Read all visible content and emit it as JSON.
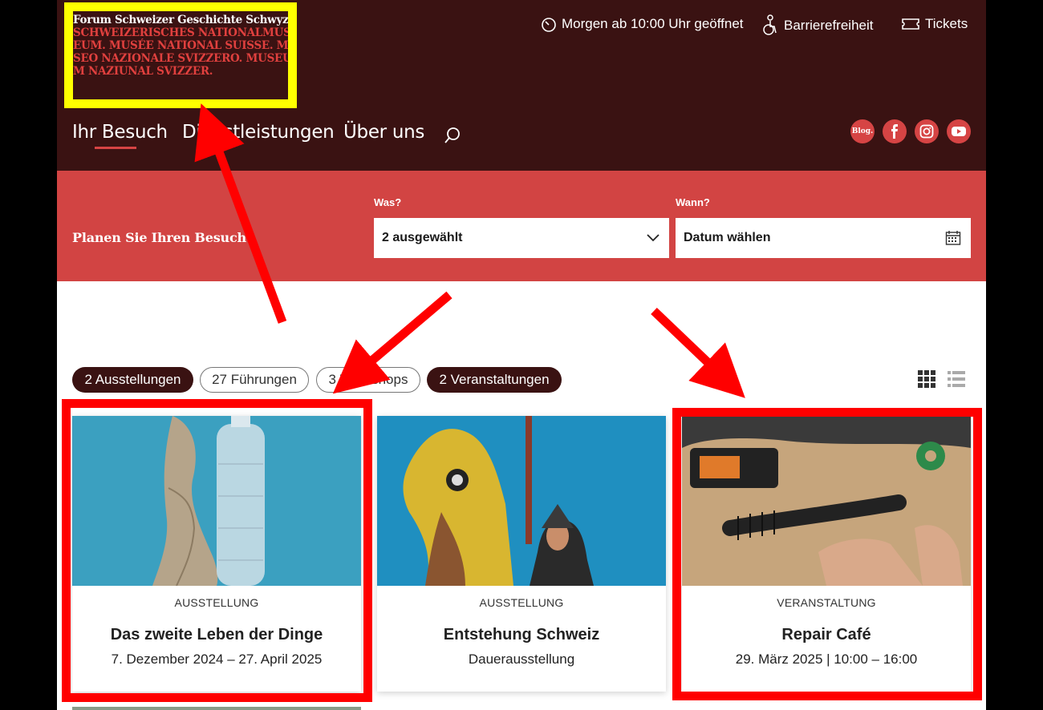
{
  "logo": {
    "line1": "Forum Schweizer Geschichte Schwyz.",
    "line2": "SCHWEIZERISCHES NATIONALMUS",
    "line3": "EUM. MUSÉE NATIONAL SUISSE. MU",
    "line4": "SEO NAZIONALE SVIZZERO. MUSEU",
    "line5": "M NAZIUNAL SVIZZER."
  },
  "utility": {
    "hours": "Morgen ab 10:00 Uhr geöffnet",
    "accessibility": "Barrierefreiheit",
    "tickets": "Tickets"
  },
  "nav": {
    "items": [
      {
        "label": "Ihr Besuch"
      },
      {
        "label": "Dienstleistungen"
      },
      {
        "label": "Über uns"
      }
    ]
  },
  "social": {
    "blog": "Blog."
  },
  "plan": {
    "title": "Planen Sie Ihren Besuch",
    "was_label": "Was?",
    "was_value": "2 ausgewählt",
    "wann_label": "Wann?",
    "wann_value": "Datum wählen"
  },
  "filters": [
    {
      "label": "2 Ausstellungen",
      "active": true
    },
    {
      "label": "27 Führungen",
      "active": false
    },
    {
      "label": "3 Workshops",
      "active": false
    },
    {
      "label": "2 Veranstaltungen",
      "active": true
    }
  ],
  "cards": [
    {
      "type": "AUSSTELLUNG",
      "title": "Das zweite Leben der Dinge",
      "subtitle": "7. Dezember 2024 – 27. April 2025"
    },
    {
      "type": "AUSSTELLUNG",
      "title": "Entstehung Schweiz",
      "subtitle": "Dauerausstellung"
    },
    {
      "type": "VERANSTALTUNG",
      "title": "Repair Café",
      "subtitle": "29. März 2025 | 10:00 – 16:00"
    }
  ],
  "colors": {
    "header_bg": "#3a1212",
    "accent": "#d24443",
    "highlight_yellow": "#ffff00",
    "highlight_red": "#ff0000"
  }
}
